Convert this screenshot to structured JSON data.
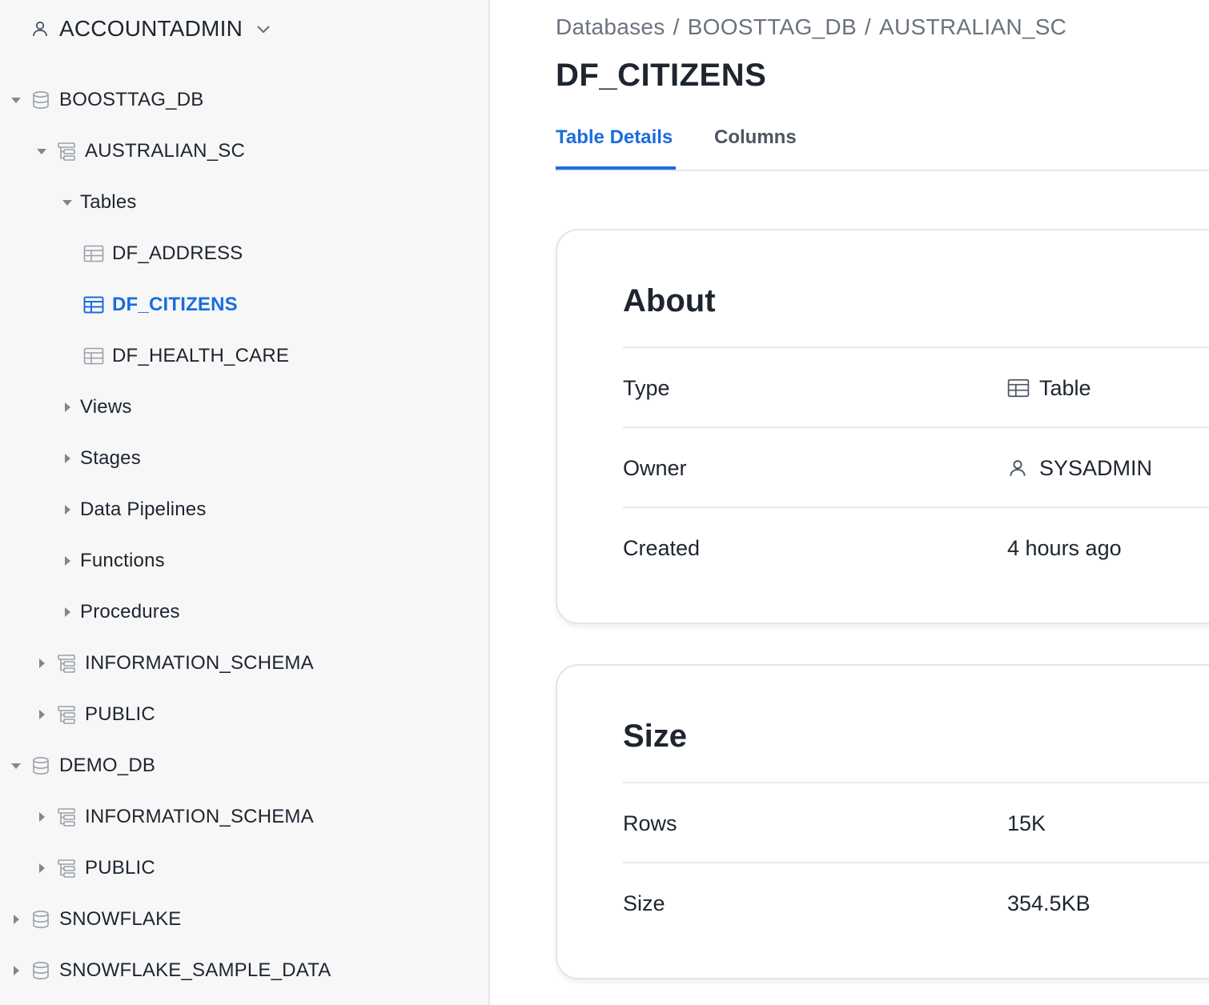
{
  "sidebar": {
    "role": "ACCOUNTADMIN",
    "tree": {
      "boosttag_db": "BOOSTTAG_DB",
      "australian_sc": "AUSTRALIAN_SC",
      "tables": "Tables",
      "df_address": "DF_ADDRESS",
      "df_citizens": "DF_CITIZENS",
      "df_health_care": "DF_HEALTH_CARE",
      "views": "Views",
      "stages": "Stages",
      "data_pipelines": "Data Pipelines",
      "functions": "Functions",
      "procedures": "Procedures",
      "information_schema_1": "INFORMATION_SCHEMA",
      "public_1": "PUBLIC",
      "demo_db": "DEMO_DB",
      "information_schema_2": "INFORMATION_SCHEMA",
      "public_2": "PUBLIC",
      "snowflake": "SNOWFLAKE",
      "snowflake_sample_data": "SNOWFLAKE_SAMPLE_DATA"
    }
  },
  "breadcrumb": {
    "databases": "Databases",
    "db": "BOOSTTAG_DB",
    "schema": "AUSTRALIAN_SC",
    "separator": "/"
  },
  "page_title": "DF_CITIZENS",
  "tabs": {
    "details": "Table Details",
    "columns": "Columns"
  },
  "about": {
    "heading": "About",
    "type_label": "Type",
    "type_value": "Table",
    "owner_label": "Owner",
    "owner_value": "SYSADMIN",
    "created_label": "Created",
    "created_value": "4 hours ago"
  },
  "size": {
    "heading": "Size",
    "rows_label": "Rows",
    "rows_value": "15K",
    "size_label": "Size",
    "size_value": "354.5KB"
  },
  "colors": {
    "accent": "#1a6ce0",
    "text": "#1e252f",
    "muted": "#6b7280",
    "sidebar_bg": "#f7f7f8",
    "border": "#e4e5e7"
  },
  "icons": [
    "user-icon",
    "chevron-down-icon",
    "database-icon",
    "schema-icon",
    "table-icon",
    "caret-down-icon",
    "caret-right-icon"
  ]
}
